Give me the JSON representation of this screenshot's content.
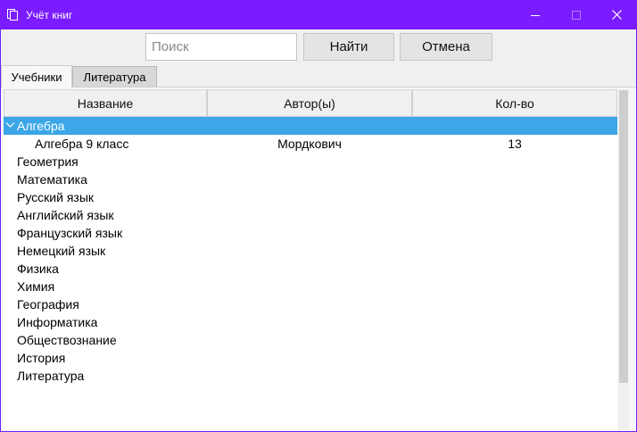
{
  "window": {
    "title": "Учёт книг"
  },
  "search": {
    "placeholder": "Поиск",
    "value": ""
  },
  "toolbar": {
    "find_label": "Найти",
    "cancel_label": "Отмена"
  },
  "tabs": [
    {
      "label": "Учебники",
      "active": true
    },
    {
      "label": "Литература",
      "active": false
    }
  ],
  "table": {
    "columns": [
      "Название",
      "Автор(ы)",
      "Кол-во"
    ],
    "rows": [
      {
        "name": "Алгебра",
        "author": "",
        "count": "",
        "level": 0,
        "expanded": true,
        "selected": true
      },
      {
        "name": "Алгебра 9 класс",
        "author": "Мордкович",
        "count": "13",
        "level": 1
      },
      {
        "name": "Геометрия",
        "author": "",
        "count": "",
        "level": 0
      },
      {
        "name": "Математика",
        "author": "",
        "count": "",
        "level": 0
      },
      {
        "name": "Русский язык",
        "author": "",
        "count": "",
        "level": 0
      },
      {
        "name": "Английский язык",
        "author": "",
        "count": "",
        "level": 0
      },
      {
        "name": "Французский язык",
        "author": "",
        "count": "",
        "level": 0
      },
      {
        "name": "Немецкий язык",
        "author": "",
        "count": "",
        "level": 0
      },
      {
        "name": "Физика",
        "author": "",
        "count": "",
        "level": 0
      },
      {
        "name": "Химия",
        "author": "",
        "count": "",
        "level": 0
      },
      {
        "name": "География",
        "author": "",
        "count": "",
        "level": 0
      },
      {
        "name": "Информатика",
        "author": "",
        "count": "",
        "level": 0
      },
      {
        "name": "Обществознание",
        "author": "",
        "count": "",
        "level": 0
      },
      {
        "name": "История",
        "author": "",
        "count": "",
        "level": 0
      },
      {
        "name": "Литература",
        "author": "",
        "count": "",
        "level": 0
      }
    ]
  },
  "icons": {
    "app": "books-icon",
    "minimize": "minimize-icon",
    "maximize": "maximize-icon",
    "close": "close-icon",
    "expand": "chevron-down-icon"
  },
  "colors": {
    "titlebar": "#7a1cff",
    "selection": "#3ba6e8"
  }
}
